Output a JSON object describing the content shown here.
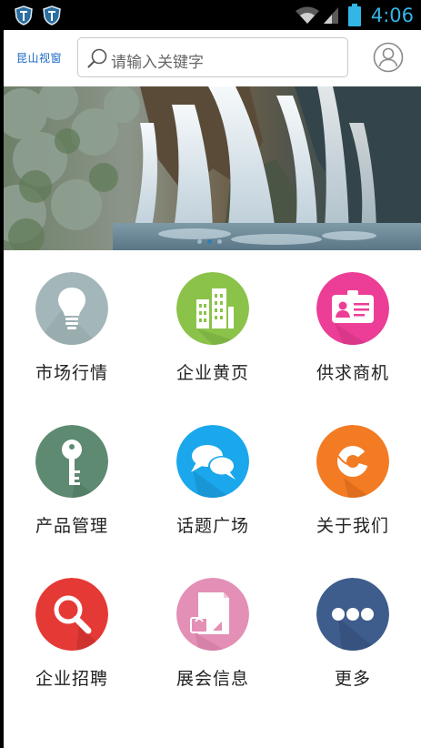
{
  "status_bar": {
    "time": "4:06",
    "icons": [
      "shield-icon",
      "shield-icon",
      "wifi-icon",
      "signal-icon",
      "battery-icon"
    ]
  },
  "header": {
    "brand": "昆山视窗",
    "search_placeholder": "请输入关键字",
    "icons": [
      "search-icon",
      "user-icon"
    ]
  },
  "banner": {
    "dots": 3,
    "active_dot": 1
  },
  "grid": {
    "items": [
      {
        "label": "市场行情",
        "icon": "lightbulb-icon",
        "color": "#a3b6b9"
      },
      {
        "label": "企业黄页",
        "icon": "building-icon",
        "color": "#8bc34a"
      },
      {
        "label": "供求商机",
        "icon": "id-card-icon",
        "color": "#ec3e96"
      },
      {
        "label": "产品管理",
        "icon": "key-icon",
        "color": "#5e8a72"
      },
      {
        "label": "话题广场",
        "icon": "chat-bubbles-icon",
        "color": "#1aa7ec"
      },
      {
        "label": "关于我们",
        "icon": "settings-icon",
        "color": "#f37b23"
      },
      {
        "label": "企业招聘",
        "icon": "magnifier-icon",
        "color": "#e53935"
      },
      {
        "label": "展会信息",
        "icon": "document-icon",
        "color": "#e48fb6"
      },
      {
        "label": "更多",
        "icon": "more-dots-icon",
        "color": "#3e5d8c"
      }
    ]
  }
}
